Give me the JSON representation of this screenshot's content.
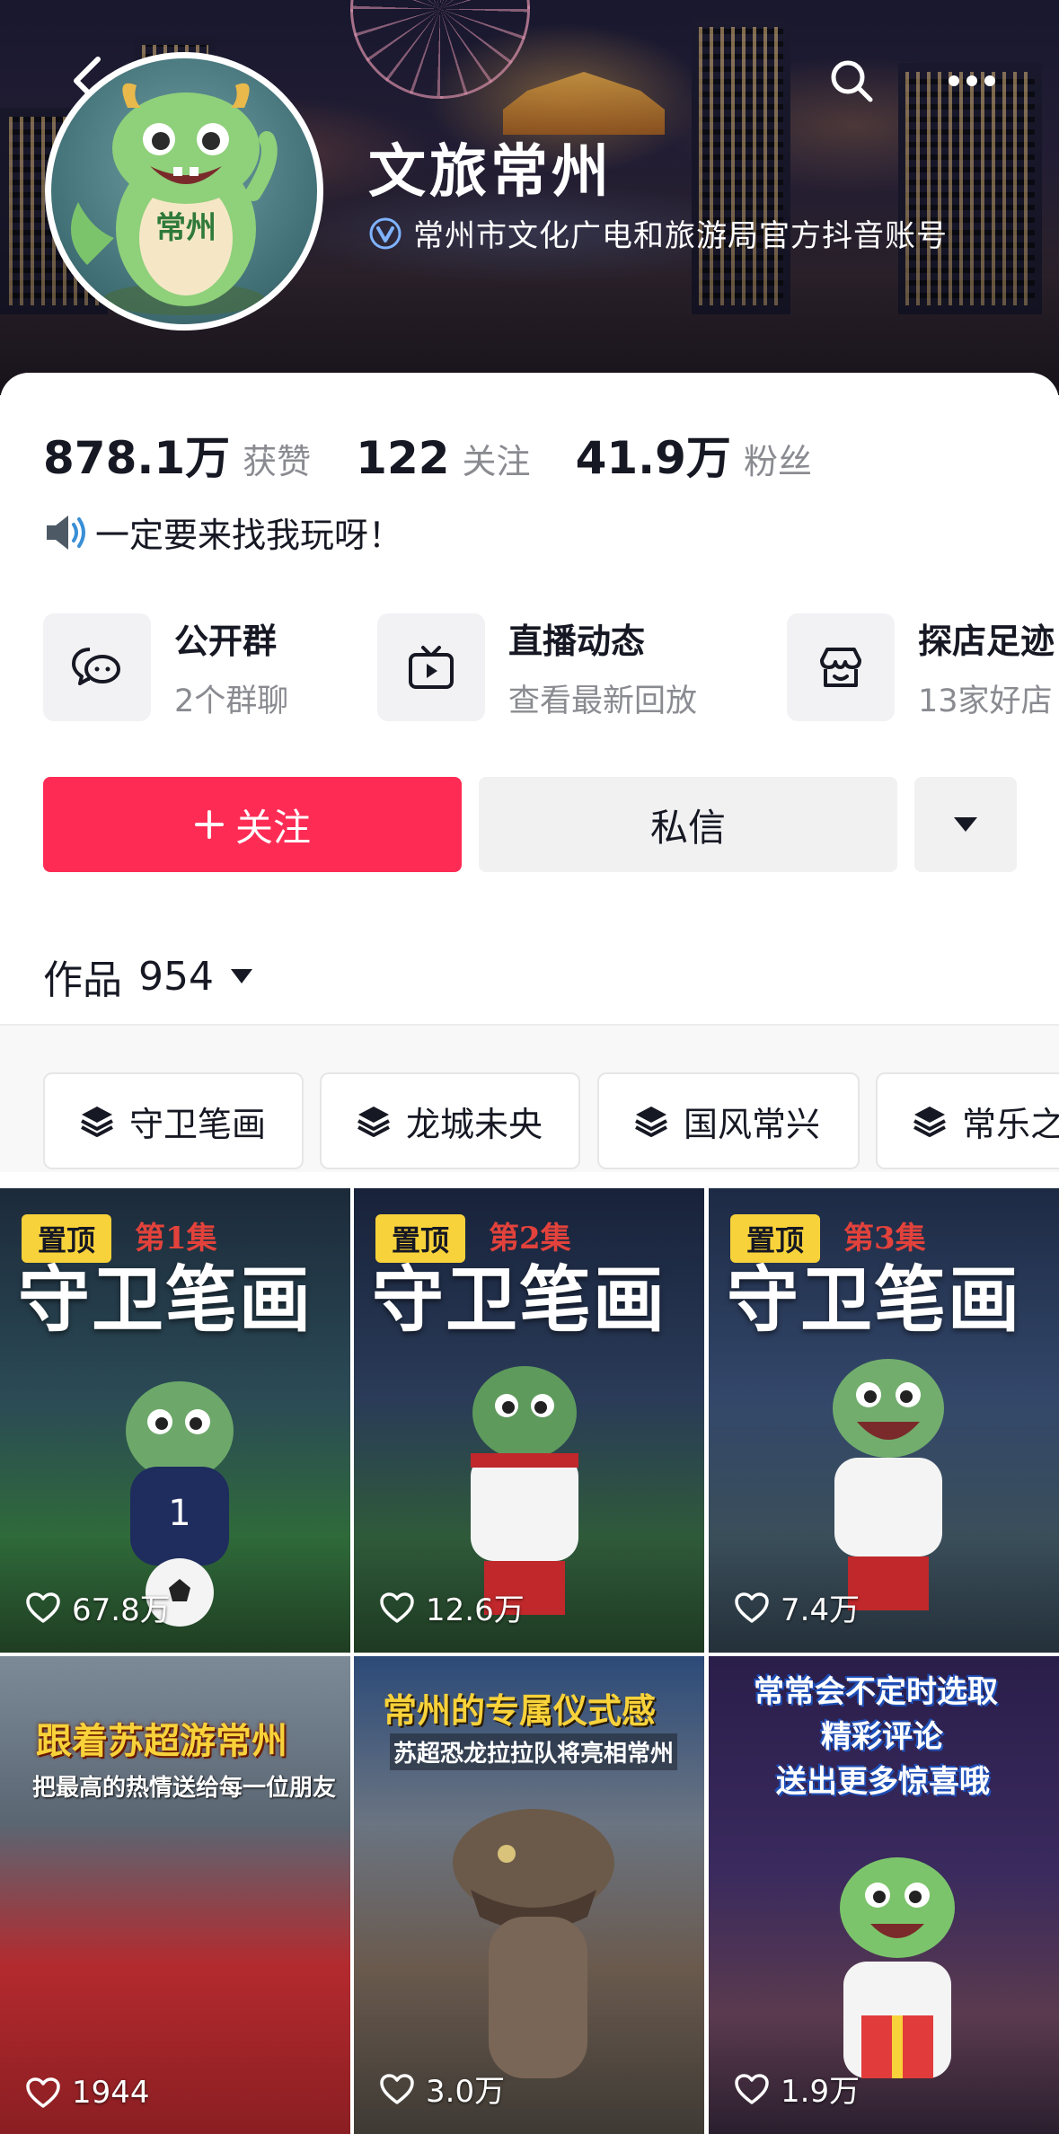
{
  "header": {
    "name": "文旅常州",
    "verified_text": "常州市文化广电和旅游局官方抖音账号",
    "avatar_text": "常州"
  },
  "stats": [
    {
      "value": "878.1万",
      "label": "获赞"
    },
    {
      "value": "122",
      "label": "关注"
    },
    {
      "value": "41.9万",
      "label": "粉丝"
    }
  ],
  "bio": "一定要来找我玩呀！",
  "features": [
    {
      "title": "公开群",
      "sub": "2个群聊",
      "icon": "group-chat-icon"
    },
    {
      "title": "直播动态",
      "sub": "查看最新回放",
      "icon": "tv-icon"
    },
    {
      "title": "探店足迹",
      "sub": "13家好店",
      "icon": "shop-icon"
    }
  ],
  "actions": {
    "follow_label": "关注",
    "message_label": "私信"
  },
  "works": {
    "label": "作品",
    "count": "954"
  },
  "collections": [
    "守卫笔画",
    "龙城未央",
    "国风常兴",
    "常乐之"
  ],
  "videos": [
    {
      "pinned": "置顶",
      "episode": "第1集",
      "title": "守卫笔画",
      "likes": "67.8万"
    },
    {
      "pinned": "置顶",
      "episode": "第2集",
      "title": "守卫笔画",
      "likes": "12.6万"
    },
    {
      "pinned": "置顶",
      "episode": "第3集",
      "title": "守卫笔画",
      "likes": "7.4万"
    },
    {
      "caption1": "跟着苏超游常州",
      "caption2": "把最高的热情送给每一位朋友",
      "likes": "1944"
    },
    {
      "caption1": "常州的专属仪式感",
      "caption2": "苏超恐龙拉拉队将亮相常州",
      "likes": "3.0万"
    },
    {
      "caption1": "常常会不定时选取",
      "caption2": "精彩评论",
      "caption3": "送出更多惊喜哦",
      "likes": "1.9万"
    }
  ],
  "colors": {
    "follow": "#fe2c55",
    "pin": "#f8d23a",
    "text": "#161823",
    "muted": "#8a8b91"
  }
}
